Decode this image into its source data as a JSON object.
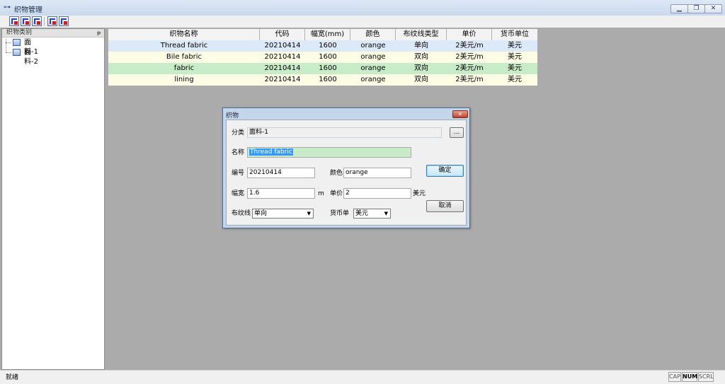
{
  "window": {
    "title": "织物管理"
  },
  "toolbar": {
    "icons": [
      "add-category-icon",
      "edit-category-icon",
      "delete-category-icon",
      "add-fabric-icon",
      "delete-fabric-icon"
    ]
  },
  "left_panel": {
    "title": "织物类别",
    "pin": "ᵽ",
    "items": [
      {
        "label": "面料-1"
      },
      {
        "label": "面料-2"
      }
    ]
  },
  "table": {
    "columns": [
      "织物名称",
      "代码",
      "幅宽(mm)",
      "颜色",
      "布纹线类型",
      "单价",
      "货币单位"
    ],
    "rows": [
      {
        "cells": [
          "Thread fabric",
          "20210414",
          "1600",
          "orange",
          "单向",
          "2美元/m",
          "美元"
        ],
        "bg": "#dbe9f8"
      },
      {
        "cells": [
          "Bile fabric",
          "20210414",
          "1600",
          "orange",
          "双向",
          "2美元/m",
          "美元"
        ],
        "bg": "#fdfde6"
      },
      {
        "cells": [
          "fabric",
          "20210414",
          "1600",
          "orange",
          "双向",
          "2美元/m",
          "美元"
        ],
        "bg": "#c8ebc8"
      },
      {
        "cells": [
          "lining",
          "20210414",
          "1600",
          "orange",
          "双向",
          "2美元/m",
          "美元"
        ],
        "bg": "#fdfde6"
      }
    ]
  },
  "dialog": {
    "title": "织物",
    "close": "✕",
    "category_label": "分类",
    "category_value": "面料-1",
    "browse_label": "...",
    "name_label": "名称",
    "name_value": "Thread fabric",
    "code_label": "编号",
    "code_value": "20210414",
    "color_label": "颜色",
    "color_value": "orange",
    "width_label": "幅宽",
    "width_value": "1.6",
    "width_unit": "m",
    "price_label": "单价",
    "price_value": "2",
    "price_unit": "美元",
    "grain_label": "布纹线",
    "grain_value": "单向",
    "currency_label": "货币单",
    "currency_value": "美元",
    "ok_label": "确定",
    "cancel_label": "取消"
  },
  "status": {
    "message": "就绪",
    "indicators": [
      "CAP",
      "NUM",
      "SCRL"
    ]
  },
  "colors": {
    "selection": "#3399ff",
    "dialog_frame": "#c4d6ea",
    "workspace": "#ababab"
  }
}
